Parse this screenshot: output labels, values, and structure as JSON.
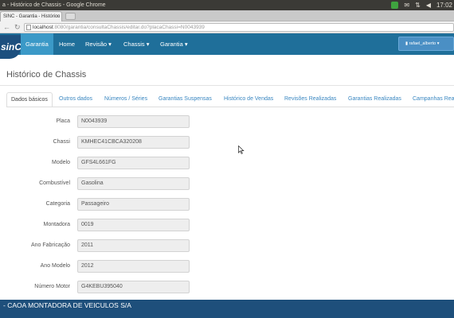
{
  "os": {
    "window_title": "a - Histórico de Chassis - Google Chrome",
    "clock": "17:02"
  },
  "browser": {
    "tab_title": "SINC - Garantia - Histórico",
    "url_host": "localhost",
    "url_path": ":8080/garantia/consultaChassis/editar.do?placaChassi=N0043939"
  },
  "navbar": {
    "logo": "sinC",
    "items": [
      {
        "label": "Garantia"
      },
      {
        "label": "Home"
      },
      {
        "label": "Revisão ▾"
      },
      {
        "label": "Chassis ▾"
      },
      {
        "label": "Garantia ▾"
      }
    ],
    "user": "rafael_alberto ▾"
  },
  "page": {
    "title": "Histórico de Chassis"
  },
  "tabs": [
    {
      "label": "Dados básicos"
    },
    {
      "label": "Outros dados"
    },
    {
      "label": "Números / Séries"
    },
    {
      "label": "Garantias Suspensas"
    },
    {
      "label": "Histórico de Vendas"
    },
    {
      "label": "Revisões Realizadas"
    },
    {
      "label": "Garantias Realizadas"
    },
    {
      "label": "Campanhas Rea"
    }
  ],
  "form": [
    {
      "label": "Placa",
      "value": "N0043939"
    },
    {
      "label": "Chassi",
      "value": "KMHEC41CBCA320208"
    },
    {
      "label": "Modelo",
      "value": "GFS4L661FG"
    },
    {
      "label": "Combustível",
      "value": "Gasolina"
    },
    {
      "label": "Categoria",
      "value": "Passageiro"
    },
    {
      "label": "Montadora",
      "value": "0019"
    },
    {
      "label": "Ano Fabricação",
      "value": "2011"
    },
    {
      "label": "Ano Modelo",
      "value": "2012"
    },
    {
      "label": "Número Motor",
      "value": "G4KEBU395040"
    }
  ],
  "footer": {
    "text": "- CAOA MONTADORA DE VEICULOS S/A"
  }
}
